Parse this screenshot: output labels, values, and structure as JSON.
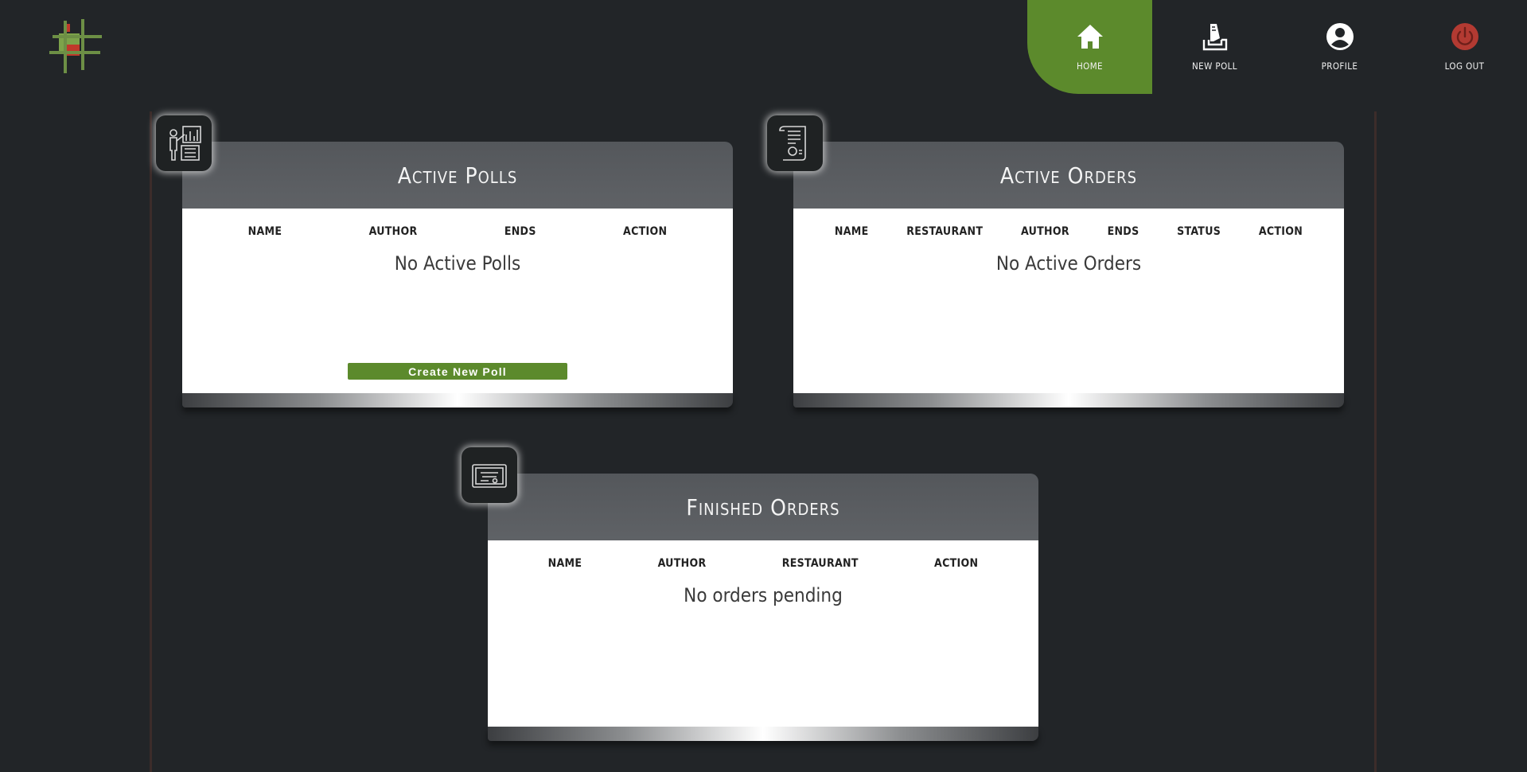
{
  "nav": {
    "items": [
      {
        "label": "HOME",
        "icon": "home-icon",
        "active": true
      },
      {
        "label": "NEW POLL",
        "icon": "ballot-box-icon",
        "active": false
      },
      {
        "label": "PROFILE",
        "icon": "user-icon",
        "active": false
      },
      {
        "label": "LOG OUT",
        "icon": "power-icon",
        "active": false
      }
    ]
  },
  "colors": {
    "accent": "#5c8a2c",
    "background": "#222528",
    "logout": "#b33a32"
  },
  "active_polls": {
    "title": "Active Polls",
    "columns": [
      "NAME",
      "AUTHOR",
      "ENDS",
      "ACTION"
    ],
    "empty_text": "No Active Polls",
    "button_label": "Create New Poll"
  },
  "active_orders": {
    "title": "Active Orders",
    "columns": [
      "NAME",
      "RESTAURANT",
      "AUTHOR",
      "ENDS",
      "STATUS",
      "ACTION"
    ],
    "empty_text": "No Active Orders"
  },
  "finished_orders": {
    "title": "Finished Orders",
    "columns": [
      "NAME",
      "AUTHOR",
      "RESTAURANT",
      "ACTION"
    ],
    "empty_text": "No orders pending"
  }
}
